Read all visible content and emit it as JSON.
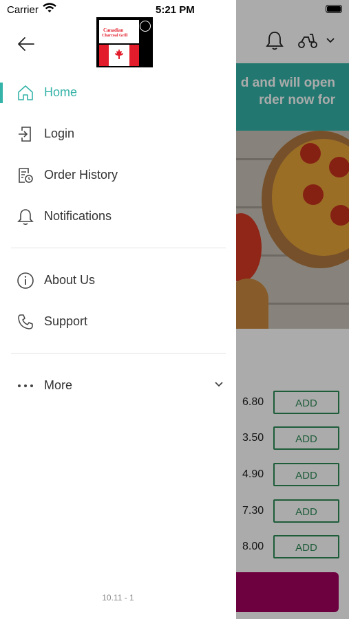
{
  "status_bar": {
    "carrier": "Carrier",
    "time": "5:21 PM"
  },
  "logo": {
    "line1": "Canadian",
    "line2": "Charcoal Grill"
  },
  "drawer": {
    "items": [
      {
        "label": "Home",
        "icon": "home-icon",
        "active": true
      },
      {
        "label": "Login",
        "icon": "login-icon",
        "active": false
      },
      {
        "label": "Order History",
        "icon": "order-history-icon",
        "active": false
      },
      {
        "label": "Notifications",
        "icon": "bell-icon",
        "active": false
      },
      {
        "label": "About Us",
        "icon": "info-icon",
        "active": false
      },
      {
        "label": "Support",
        "icon": "phone-icon",
        "active": false
      }
    ],
    "more_label": "More",
    "version": "10.11 - 1"
  },
  "background": {
    "banner_line1": "d and will open",
    "banner_line2": "rder now for",
    "menu": [
      {
        "price": "6.80",
        "button": "ADD"
      },
      {
        "price": "3.50",
        "button": "ADD"
      },
      {
        "price": "4.90",
        "button": "ADD"
      },
      {
        "price": "7.30",
        "button": "ADD"
      },
      {
        "price": "8.00",
        "button": "ADD"
      }
    ]
  },
  "colors": {
    "accent": "#34b3a8",
    "add_border": "#2e8b57",
    "checkout": "#a3005f",
    "flag_red": "#e21c2a"
  }
}
